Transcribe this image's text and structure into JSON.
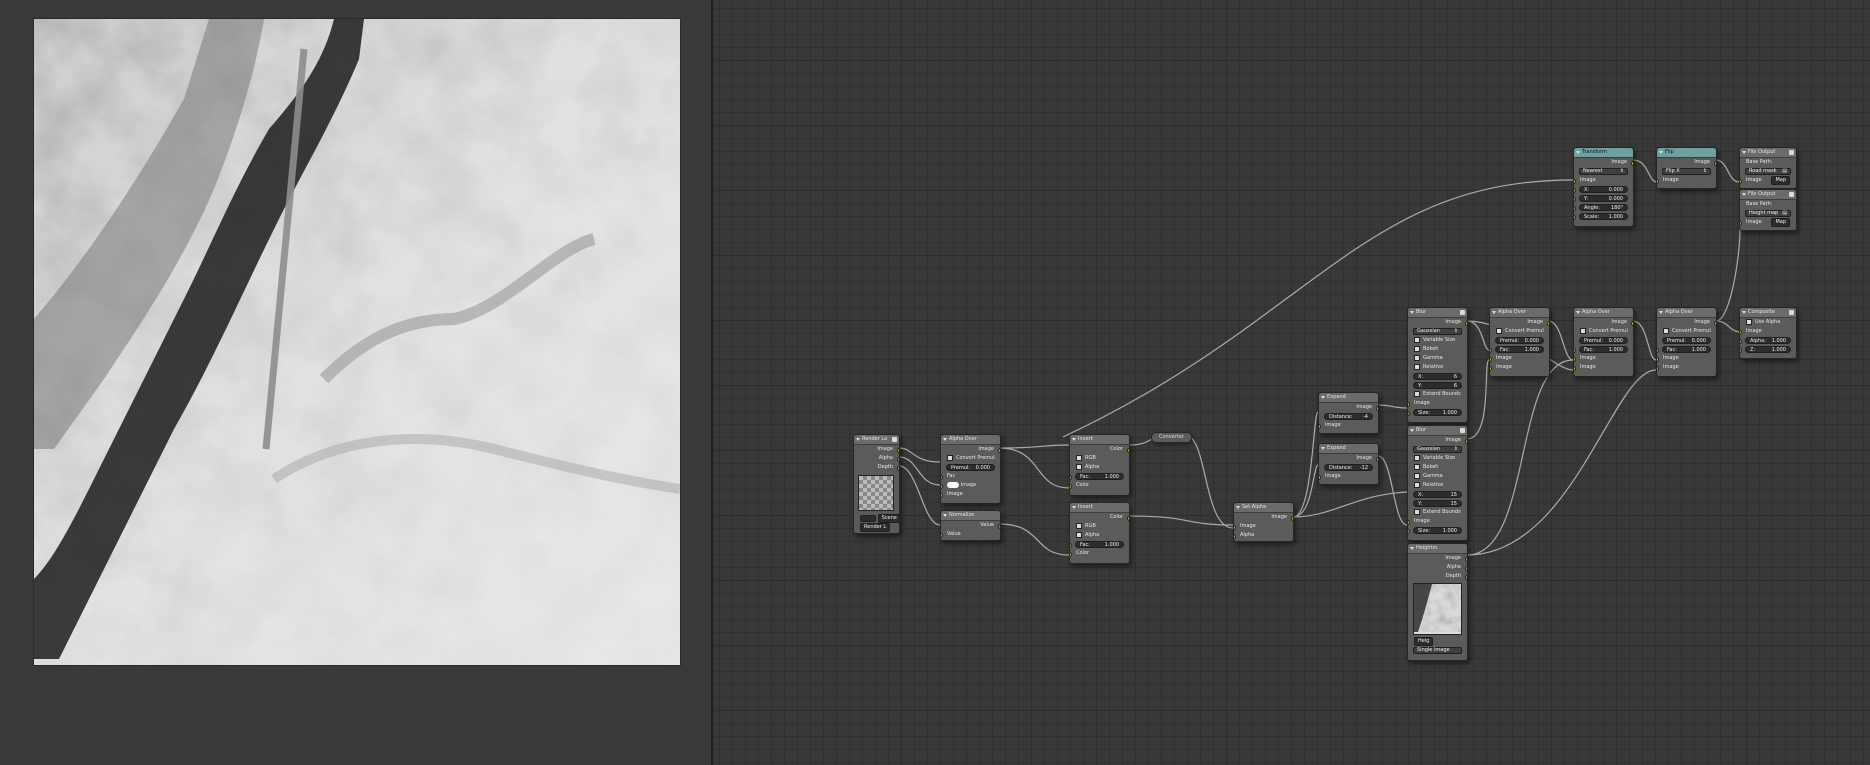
{
  "colors": {
    "socket_color": "#c7c729",
    "socket_value": "#a1a1a1",
    "socket_vector": "#6e7ec8",
    "node_body": "#5b5b5b",
    "node_header": "#6b6b6b",
    "output_header": "#6fa0a0",
    "wire": "#b8b8b8"
  },
  "nodes": {
    "render_layers": {
      "title": "Render La",
      "out_image": "Image",
      "out_alpha": "Alpha",
      "out_depth": "Depth",
      "layer": "RenderLayer",
      "scene": "Scene",
      "scene_icon": "scene-icon",
      "layer_btn": "Render L"
    },
    "alpha_over_1": {
      "title": "Alpha Over",
      "out_image": "Image",
      "convert_premul": "Convert Premul",
      "premul_label": "Premul:",
      "premul_value": "0.000",
      "in_fac": "Fac",
      "in_image": "Image",
      "in_image2": "Image"
    },
    "normalize": {
      "title": "Normalize",
      "out_value": "Value",
      "in_value": "Value"
    },
    "invert_1": {
      "title": "Invert",
      "out_color": "Color",
      "rgb": "RGB",
      "alpha": "Alpha",
      "fac_label": "Fac:",
      "fac_value": "1.000",
      "in_color": "Color"
    },
    "invert_2": {
      "title": "Invert",
      "out_color": "Color",
      "rgb": "RGB",
      "alpha": "Alpha",
      "fac_label": "Fac:",
      "fac_value": "1.000",
      "in_color": "Color"
    },
    "converter": {
      "title": "Converter"
    },
    "set_alpha": {
      "title": "Set Alpha",
      "out_image": "Image",
      "in_image": "Image",
      "in_alpha": "Alpha"
    },
    "expand_1": {
      "title": "Expand",
      "distance_label": "Distance:",
      "distance_value": "-4",
      "in_image": "Image",
      "out_image": "Image"
    },
    "expand_2": {
      "title": "Expand",
      "distance_label": "Distance:",
      "distance_value": "-12",
      "in_image": "Image",
      "out_image": "Image"
    },
    "blur_1": {
      "title": "Blur",
      "out_image": "Image",
      "filter": "Gaussian",
      "variable_size": "Variable Size",
      "bokeh": "Bokeh",
      "gamma": "Gamma",
      "relative": "Relative",
      "x_label": "X:",
      "x_value": "6",
      "y_label": "Y:",
      "y_value": "6",
      "extend_bounds": "Extend Bounds",
      "in_image": "Image",
      "size_label": "Size:",
      "size_value": "1.000"
    },
    "blur_2": {
      "title": "Blur",
      "out_image": "Image",
      "filter": "Gaussian",
      "variable_size": "Variable Size",
      "bokeh": "Bokeh",
      "gamma": "Gamma",
      "relative": "Relative",
      "x_label": "X:",
      "x_value": "15",
      "y_label": "Y:",
      "y_value": "15",
      "extend_bounds": "Extend Bounds",
      "in_image": "Image",
      "size_label": "Size:",
      "size_value": "1.000"
    },
    "image_node": {
      "title": "Heightm",
      "out_image": "Image",
      "out_alpha": "Alpha",
      "out_depth": "Depth",
      "file": "Heig",
      "source": "Single Image"
    },
    "alpha_over_2": {
      "title": "Alpha Over",
      "out_image": "Image",
      "convert_premul": "Convert Premul",
      "premul_label": "Premul:",
      "premul_value": "0.000",
      "fac_label": "Fac:",
      "fac_value": "1.000",
      "in_image": "Image",
      "in_image2": "Image"
    },
    "alpha_over_3": {
      "title": "Alpha Over",
      "out_image": "Image",
      "convert_premul": "Convert Premul",
      "premul_label": "Premul:",
      "premul_value": "0.000",
      "fac_label": "Fac:",
      "fac_value": "1.000",
      "in_image": "Image",
      "in_image2": "Image"
    },
    "alpha_over_4": {
      "title": "Alpha Over",
      "out_image": "Image",
      "convert_premul": "Convert Premul",
      "premul_label": "Premul:",
      "premul_value": "0.000",
      "fac_label": "Fac:",
      "fac_value": "1.000",
      "in_image": "Image",
      "in_image2": "Image"
    },
    "composite": {
      "title": "Composite",
      "use_alpha": "Use Alpha",
      "in_image": "Image",
      "alpha_label": "Alpha:",
      "alpha_value": "1.000",
      "z_label": "Z:",
      "z_value": "1.000"
    },
    "transform": {
      "title": "Transform",
      "out_image": "Image",
      "filter": "Nearest",
      "in_image": "Image",
      "x_label": "X:",
      "x_value": "0.000",
      "y_label": "Y:",
      "y_value": "0.000",
      "angle_label": "Angle:",
      "angle_value": "180°",
      "scale_label": "Scale:",
      "scale_value": "1.000"
    },
    "flip": {
      "title": "Flip",
      "out_image": "Image",
      "axis": "Flip X",
      "in_image": "Image"
    },
    "file_output_1": {
      "title": "File Output",
      "base_path": "Base Path:",
      "path_value": "Road mask",
      "in_image": "Image",
      "map_label": "Map"
    },
    "file_output_2": {
      "title": "File Output",
      "base_path": "Base Path:",
      "path_value": "Height map",
      "in_image": "Image",
      "map_label": "Map"
    }
  }
}
